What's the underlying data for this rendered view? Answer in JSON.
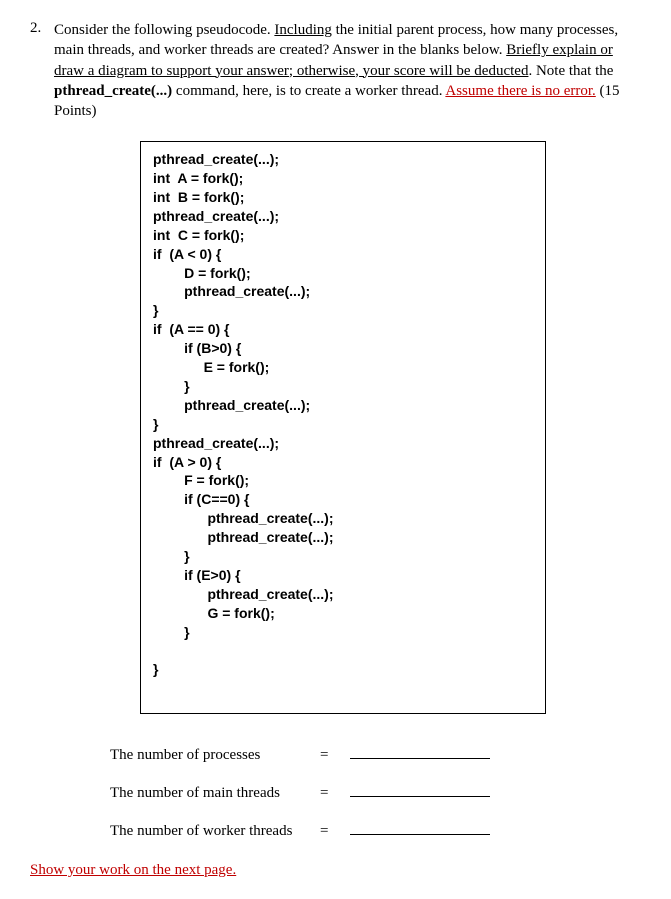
{
  "question": {
    "number": "2.",
    "text_part1": "Consider the following pseudocode. ",
    "text_underline1": "Including",
    "text_part2": " the initial parent process, how many processes, main threads, and worker threads are created? Answer in the blanks below. ",
    "text_underline2": "Briefly explain or draw a diagram to support your answer; otherwise, your score will be deducted",
    "text_part3": ". Note that the ",
    "text_bold": "pthread_create(...)",
    "text_part4": " command, here, is to create a worker thread. ",
    "text_red_underline": "Assume there is no error.",
    "text_points": " (15 Points)"
  },
  "code": "pthread_create(...);\nint  A = fork();\nint  B = fork();\npthread_create(...);\nint  C = fork();\nif  (A < 0) {\n        D = fork();\n        pthread_create(...);\n}\nif  (A == 0) {\n        if (B>0) {\n             E = fork();\n        }\n        pthread_create(...);\n}\npthread_create(...);\nif  (A > 0) {\n        F = fork();\n        if (C==0) {\n              pthread_create(...);\n              pthread_create(...);\n        }\n        if (E>0) {\n              pthread_create(...);\n              G = fork();\n        }\n\n}",
  "answers": {
    "row1": "The number of processes",
    "row2": "The number of main threads",
    "row3": "The number of worker threads",
    "equals": "="
  },
  "footer": "Show your work on the next page."
}
